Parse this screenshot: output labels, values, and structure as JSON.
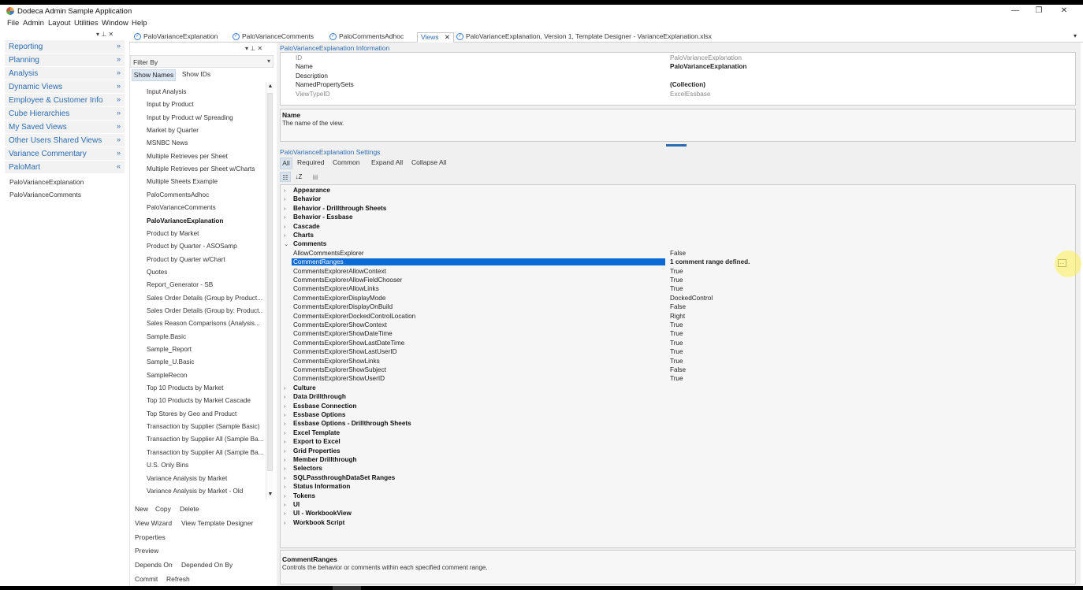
{
  "app": {
    "title": "Dodeca Admin Sample Application"
  },
  "window_controls": {
    "minimize": "—",
    "restore": "❐",
    "close": "✕"
  },
  "menu": [
    "File",
    "Admin",
    "Layout",
    "Utilities",
    "Window",
    "Help"
  ],
  "left_nav": {
    "pin": "▾  ⊥  ✕",
    "groups": [
      {
        "label": "Reporting",
        "chevron": "»"
      },
      {
        "label": "Planning",
        "chevron": "»"
      },
      {
        "label": "Analysis",
        "chevron": "»"
      },
      {
        "label": "Dynamic Views",
        "chevron": "»"
      },
      {
        "label": "Employee & Customer Info",
        "chevron": "»"
      },
      {
        "label": "Cube Hierarchies",
        "chevron": "»"
      },
      {
        "label": "My Saved Views",
        "chevron": "»"
      },
      {
        "label": "Other Users Shared Views",
        "chevron": "»"
      },
      {
        "label": "Variance Commentary",
        "chevron": "»"
      },
      {
        "label": "PaloMart",
        "chevron": "«"
      }
    ],
    "sub_items": [
      "PaloVarianceExplanation",
      "PaloVarianceComments"
    ]
  },
  "tabs": [
    {
      "label": "PaloVarianceExplanation",
      "icon": true
    },
    {
      "label": "PaloVarianceComments",
      "icon": true
    },
    {
      "label": "PaloCommentsAdhoc",
      "icon": true
    },
    {
      "label": "Views",
      "close": "✕",
      "active": true
    },
    {
      "label": "PaloVarianceExplanation, Version 1, Template Designer - VarianceExplanation.xlsx",
      "icon": true
    }
  ],
  "tab_dropdown": "▾",
  "list_panel": {
    "header_controls": "▾  ⊥  ✕",
    "filter_label": "Filter By",
    "filter_arrow": "▾",
    "show_names": "Show Names",
    "show_ids": "Show IDs",
    "scroll_up": "▲",
    "scroll_down": "▼",
    "items": [
      "Input Analysis",
      "Input by Product",
      "Input by Product w/ Spreading",
      "Market by Quarter",
      "MSNBC News",
      "Multiple Retrieves per Sheet",
      "Multiple Retrieves per Sheet w/Charts",
      "Multiple Sheets Example",
      "PaloCommentsAdhoc",
      "PaloVarianceComments",
      "PaloVarianceExplanation",
      "Product by Market",
      "Product by Quarter - ASOSamp",
      "Product by Quarter w/Chart",
      "Quotes",
      "Report_Generator - SB",
      "Sales Order Details (Group by Product...",
      "Sales Order Details (Group by: Product...",
      "Sales Reason Comparisons (Analysis...",
      "Sample.Basic",
      "Sample_Report",
      "Sample_U.Basic",
      "SampleRecon",
      "Top 10 Products by Market",
      "Top 10 Products by Market Cascade",
      "Top Stores by Geo and Product",
      "Transaction by Supplier (Sample Basic)",
      "Transaction by Supplier All (Sample Ba...",
      "Transaction by Supplier All (Sample Ba...",
      "U.S. Only Bins",
      "Variance Analysis by Market",
      "Variance Analysis by Market - Old"
    ],
    "selected_index": 10,
    "actions": {
      "new": "New",
      "copy": "Copy",
      "delete": "Delete",
      "view_wizard": "View Wizard",
      "view_template_designer": "View Template Designer",
      "properties": "Properties",
      "preview": "Preview",
      "depends_on": "Depends On",
      "depended_on_by": "Depended On By",
      "commit": "Commit",
      "refresh": "Refresh"
    }
  },
  "info": {
    "title": "PaloVarianceExplanation Information",
    "rows": [
      {
        "name": "ID",
        "value": "PaloVarianceExplanation",
        "dim": true
      },
      {
        "name": "Name",
        "value": "PaloVarianceExplanation",
        "bold": true
      },
      {
        "name": "Description",
        "value": ""
      },
      {
        "name": "NamedPropertySets",
        "value": "(Collection)",
        "bold": true
      },
      {
        "name": "ViewTypeID",
        "value": "ExcelEssbase",
        "dim": true
      }
    ],
    "desc_title": "Name",
    "desc_text": "The name of the view."
  },
  "settings": {
    "title": "PaloVarianceExplanation Settings",
    "filters": {
      "all": "All",
      "required": "Required",
      "common": "Common",
      "expand_all": "Expand All",
      "collapse_all": "Collapse All"
    },
    "toolbar_icons": {
      "categorized": "☷",
      "alphabetical": "↓Z",
      "pages": "▤"
    },
    "expand_glyph": "›",
    "collapse_glyph": "⌄",
    "ellipsis": "…",
    "rows": [
      {
        "name": "Appearance",
        "cat": true
      },
      {
        "name": "Behavior",
        "cat": true
      },
      {
        "name": "Behavior - Drillthrough Sheets",
        "cat": true
      },
      {
        "name": "Behavior - Essbase",
        "cat": true
      },
      {
        "name": "Cascade",
        "cat": true
      },
      {
        "name": "Charts",
        "cat": true
      },
      {
        "name": "Comments",
        "cat": true,
        "expanded": true
      },
      {
        "name": "AllowCommentsExplorer",
        "value": "False"
      },
      {
        "name": "CommentRanges",
        "value": "1 comment range defined.",
        "bold": true,
        "selected": true
      },
      {
        "name": "CommentsExplorerAllowContext",
        "value": "True"
      },
      {
        "name": "CommentsExplorerAllowFieldChooser",
        "value": "True"
      },
      {
        "name": "CommentsExplorerAllowLinks",
        "value": "True"
      },
      {
        "name": "CommentsExplorerDisplayMode",
        "value": "DockedControl"
      },
      {
        "name": "CommentsExplorerDisplayOnBuild",
        "value": "False"
      },
      {
        "name": "CommentsExplorerDockedControlLocation",
        "value": "Right"
      },
      {
        "name": "CommentsExplorerShowContext",
        "value": "True"
      },
      {
        "name": "CommentsExplorerShowDateTime",
        "value": "True"
      },
      {
        "name": "CommentsExplorerShowLastDateTime",
        "value": "True"
      },
      {
        "name": "CommentsExplorerShowLastUserID",
        "value": "True"
      },
      {
        "name": "CommentsExplorerShowLinks",
        "value": "True"
      },
      {
        "name": "CommentsExplorerShowSubject",
        "value": "False"
      },
      {
        "name": "CommentsExplorerShowUserID",
        "value": "True"
      },
      {
        "name": "Culture",
        "cat": true
      },
      {
        "name": "Data Drillthrough",
        "cat": true
      },
      {
        "name": "Essbase Connection",
        "cat": true
      },
      {
        "name": "Essbase Options",
        "cat": true
      },
      {
        "name": "Essbase Options - Drillthrough Sheets",
        "cat": true
      },
      {
        "name": "Excel Template",
        "cat": true
      },
      {
        "name": "Export to Excel",
        "cat": true
      },
      {
        "name": "Grid Properties",
        "cat": true
      },
      {
        "name": "Member Drillthrough",
        "cat": true
      },
      {
        "name": "Selectors",
        "cat": true
      },
      {
        "name": "SQLPassthroughDataSet Ranges",
        "cat": true
      },
      {
        "name": "Status Information",
        "cat": true
      },
      {
        "name": "Tokens",
        "cat": true
      },
      {
        "name": "UI",
        "cat": true
      },
      {
        "name": "UI - WorkbookView",
        "cat": true
      },
      {
        "name": "Workbook Script",
        "cat": true
      }
    ],
    "desc_title": "CommentRanges",
    "desc_text": "Controls the behavior or comments within each specified comment range."
  },
  "colors": {
    "accent": "#2b6cb0",
    "selection": "#0a6ad6",
    "highlight": "#fff050"
  }
}
